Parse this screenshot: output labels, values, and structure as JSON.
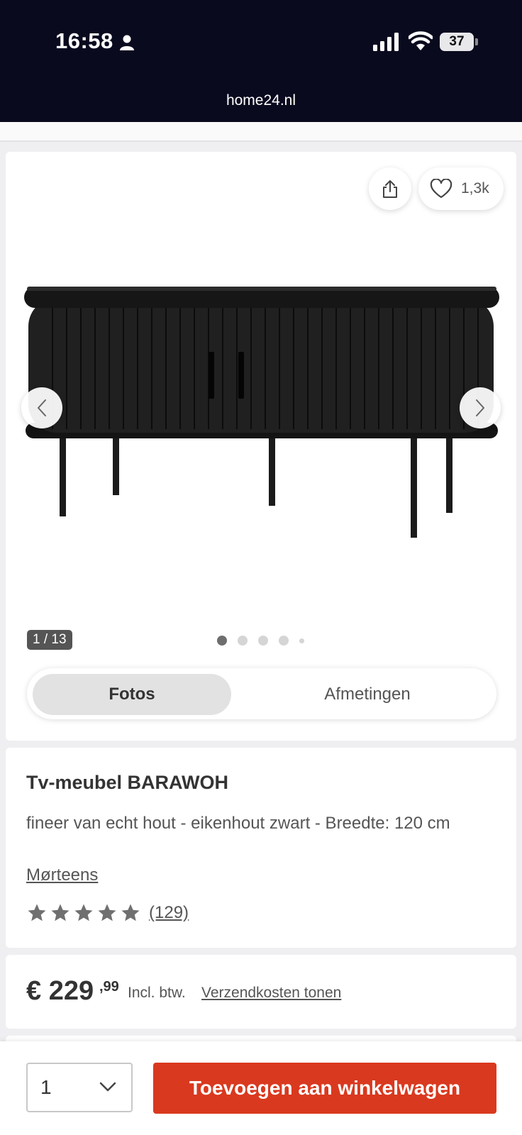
{
  "status_bar": {
    "time": "16:58",
    "battery": "37"
  },
  "browser": {
    "url": "home24.nl"
  },
  "gallery": {
    "wishlist_count": "1,3k",
    "counter": "1 / 13",
    "tabs": [
      {
        "label": "Fotos",
        "active": true
      },
      {
        "label": "Afmetingen",
        "active": false
      }
    ]
  },
  "product": {
    "title": "Tv-meubel BARAWOH",
    "subtitle": "fineer van echt hout - eikenhout zwart - Breedte: 120 cm",
    "brand": "Mørteens",
    "rating": 5,
    "review_count": "(129)"
  },
  "price": {
    "main": "€ 229",
    "cents": ",99",
    "vat": "Incl. btw.",
    "shipping_link": "Verzendkosten tonen"
  },
  "cart": {
    "quantity": "1",
    "add_button": "Toevoegen aan winkelwagen"
  },
  "colors": {
    "accent": "#d9391f",
    "topbar": "#0a0a1f"
  }
}
